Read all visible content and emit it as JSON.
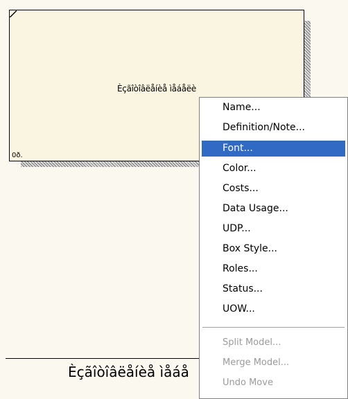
{
  "diagram": {
    "box_title": "Èçãîòîâëåíèå ìåáåëè",
    "node_number": "0ð.",
    "bottom_caption": "Èçãîòîâëåíèå ìåáå"
  },
  "context_menu": {
    "items": [
      {
        "label": "Name...",
        "state": "normal"
      },
      {
        "label": "Definition/Note...",
        "state": "normal"
      },
      {
        "label": "Font...",
        "state": "selected"
      },
      {
        "label": "Color...",
        "state": "normal"
      },
      {
        "label": "Costs...",
        "state": "normal"
      },
      {
        "label": "Data Usage...",
        "state": "normal"
      },
      {
        "label": "UDP...",
        "state": "normal"
      },
      {
        "label": "Box Style...",
        "state": "normal"
      },
      {
        "label": "Roles...",
        "state": "normal"
      },
      {
        "label": "Status...",
        "state": "normal"
      },
      {
        "label": "UOW...",
        "state": "normal"
      }
    ],
    "disabled_items": [
      {
        "label": "Split Model...",
        "state": "disabled"
      },
      {
        "label": "Merge Model...",
        "state": "disabled"
      },
      {
        "label": "Undo Move",
        "state": "disabled"
      }
    ],
    "selection_color": "#316ac5"
  }
}
